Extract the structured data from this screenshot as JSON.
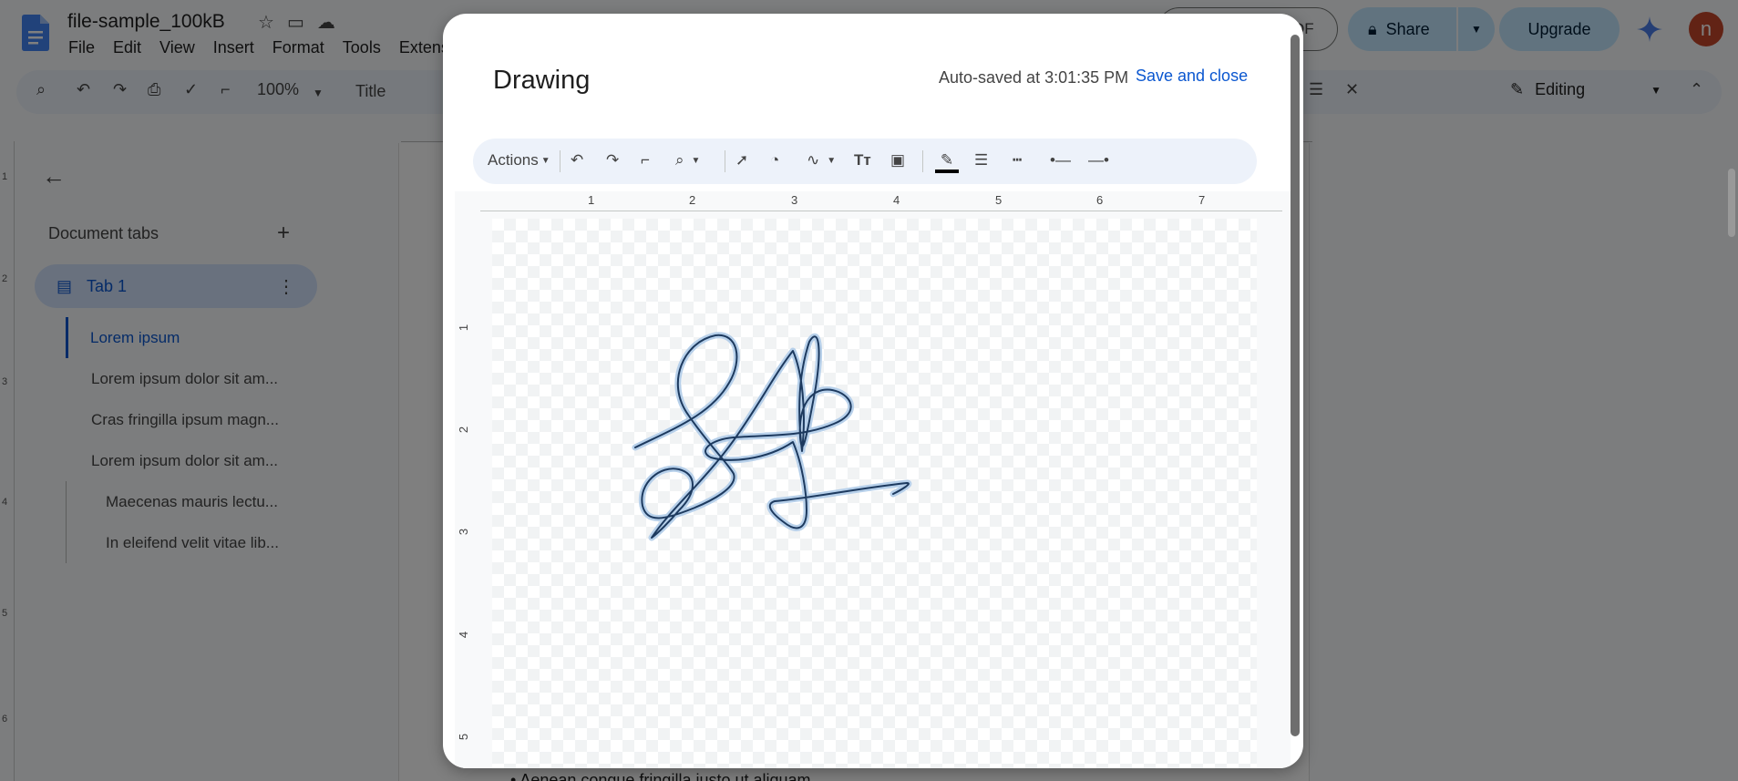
{
  "app": {
    "doc_title": "file-sample_100kB",
    "menu": [
      "File",
      "Edit",
      "View",
      "Insert",
      "Format",
      "Tools",
      "Extens"
    ],
    "pdf_fragment": "DF",
    "share_label": "Share",
    "upgrade_label": "Upgrade",
    "avatar_letter": "n",
    "zoom": "100%",
    "style_select": "Title",
    "mode_label": "Editing",
    "accent_color": "#0b57d0"
  },
  "sidebar": {
    "heading": "Document tabs",
    "tab_label": "Tab 1",
    "outline": [
      "Lorem ipsum",
      "Lorem ipsum dolor sit am...",
      "Cras fringilla ipsum magn...",
      "Lorem ipsum dolor sit am...",
      "Maecenas mauris lectu...",
      "In eleifend velit vitae lib..."
    ]
  },
  "page": {
    "visible_text": "Aenean congue fringilla justo ut aliquam"
  },
  "dialog": {
    "title": "Drawing",
    "autosave": "Auto-saved at 3:01:35 PM",
    "save_close": "Save and close",
    "toolbar": {
      "actions_label": "Actions",
      "icons": [
        "undo-icon",
        "redo-icon",
        "paint-format-icon",
        "zoom-icon",
        "select-icon",
        "shape-icon",
        "scribble-icon",
        "text-box-icon",
        "image-icon",
        "line-color-icon",
        "line-weight-icon",
        "line-dash-icon",
        "line-start-icon",
        "line-end-icon"
      ]
    },
    "ruler_h": [
      "1",
      "2",
      "3",
      "4",
      "5",
      "6",
      "7"
    ],
    "ruler_v": [
      "1",
      "2",
      "3",
      "4",
      "5"
    ]
  },
  "doc_ruler_v": [
    "1",
    "2",
    "3",
    "4",
    "5",
    "6"
  ]
}
